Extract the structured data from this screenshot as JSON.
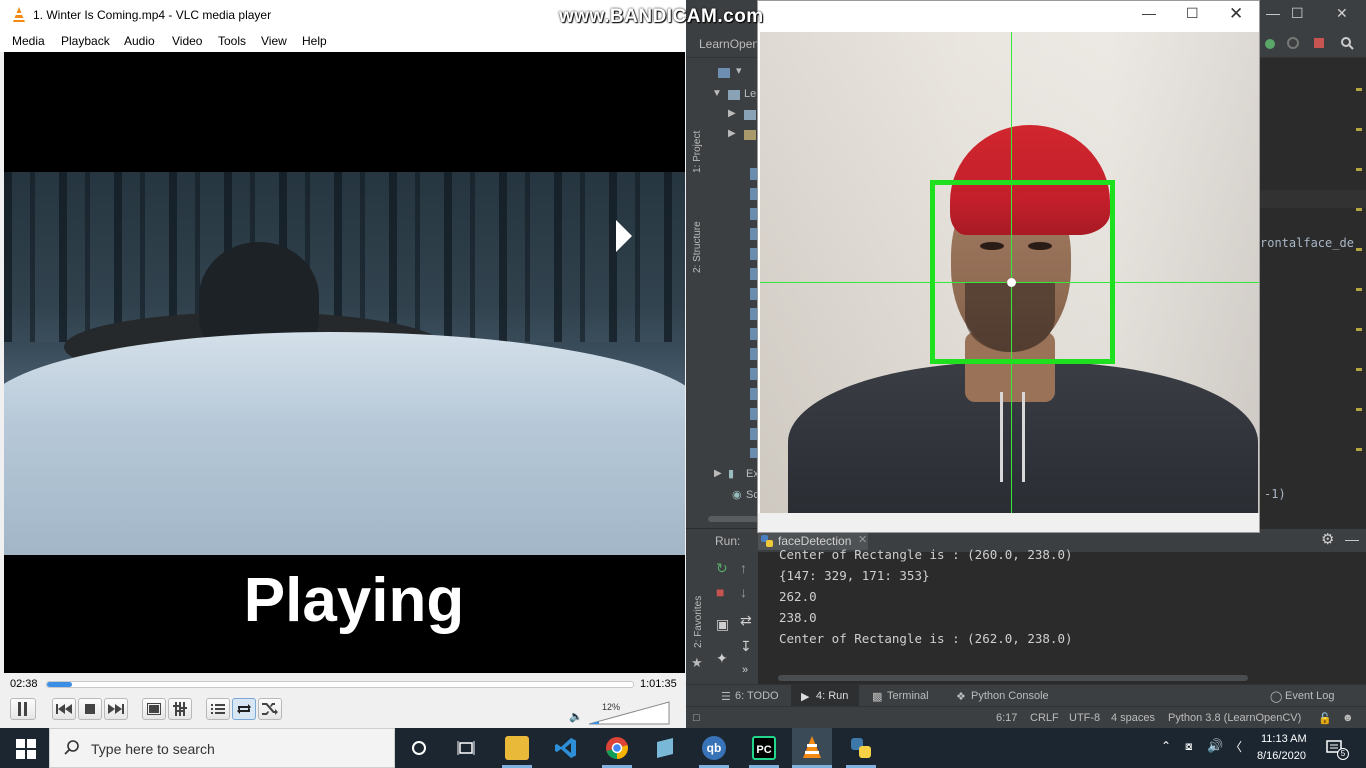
{
  "vlc": {
    "title": "1. Winter Is Coming.mp4 - VLC media player",
    "menu": [
      "Media",
      "Playback",
      "Audio",
      "Video",
      "Tools",
      "View",
      "Help"
    ],
    "overlay_text": "Playing",
    "time_current": "02:38",
    "time_total": "1:01:35",
    "seek_progress": 0.043,
    "volume": "12%",
    "accent": "#3a8ee6",
    "controls": [
      "pause-icon",
      "prev-icon",
      "stop-icon",
      "next-icon",
      "fullscreen-icon",
      "extended-settings-icon",
      "playlist-icon",
      "loop-icon",
      "shuffle-icon"
    ]
  },
  "pycharm": {
    "project_short": "LearnOpen",
    "side_tabs": [
      "1: Project",
      "2: Structure",
      "2: Favorites"
    ],
    "tree": [
      "Le",
      "Ex",
      "Sc"
    ],
    "code_fragment_1": "rontalface_de",
    "code_fragment_2": "-1)",
    "run": {
      "label": "Run:",
      "tab": "faceDetection",
      "console_lines": [
        "Center of Rectangle is : (260.0, 238.0)",
        "{147: 329, 171: 353}",
        "262.0",
        "238.0",
        "Center of Rectangle is : (262.0, 238.0)"
      ]
    },
    "bottom_tabs": [
      "6: TODO",
      "4: Run",
      "Terminal",
      "Python Console",
      "Event Log"
    ],
    "status": {
      "position": "6:17",
      "line_sep": "CRLF",
      "encoding": "UTF-8",
      "indent": "4 spaces",
      "interpreter": "Python 3.8 (LearnOpenCV)"
    }
  },
  "face_window": {
    "title": "",
    "box_color": "#1fe01f",
    "crosshair_color": "#38e838"
  },
  "watermark": "www.BANDICAM.com",
  "taskbar": {
    "search_placeholder": "Type here to search",
    "time": "11:13 AM",
    "date": "8/16/2020",
    "notifications": "5",
    "apps": [
      "task-view",
      "file-explorer",
      "vscode",
      "chrome",
      "app",
      "qbittorrent",
      "pycharm",
      "vlc",
      "python"
    ]
  }
}
